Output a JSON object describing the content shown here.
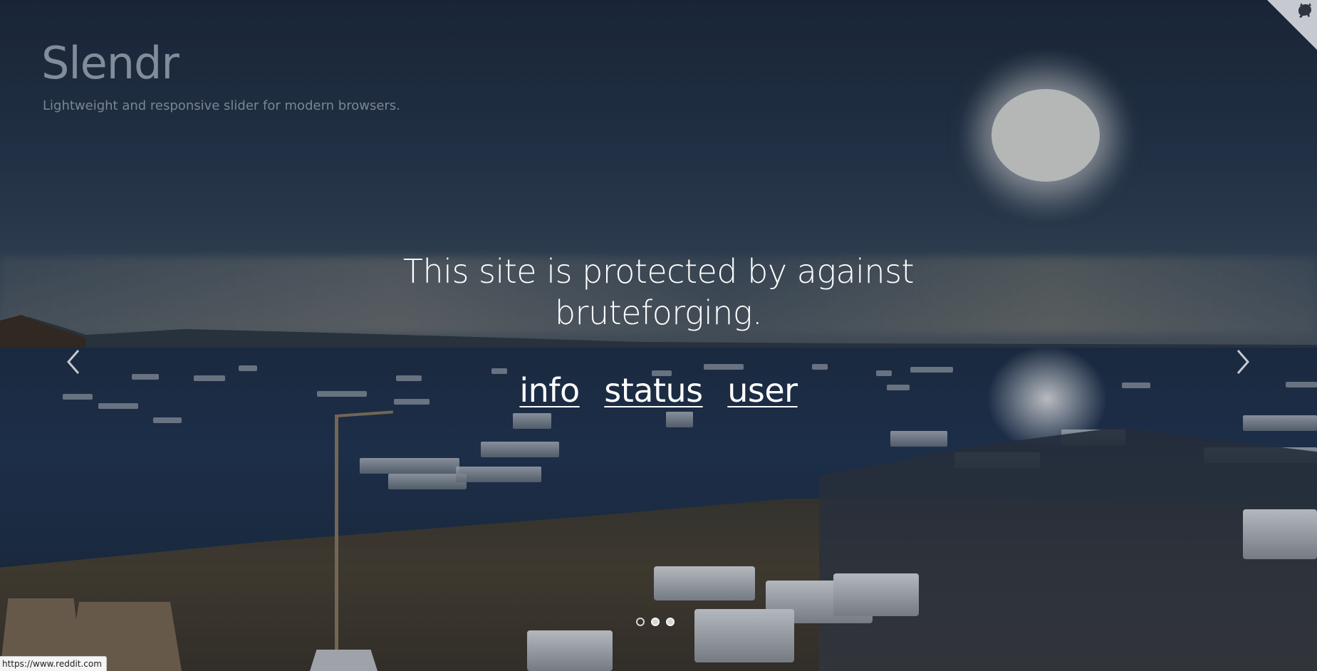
{
  "header": {
    "title": "Slendr",
    "subtitle": "Lightweight and responsive slider for modern browsers."
  },
  "slide": {
    "message": "This site is protected by against bruteforging.",
    "links": [
      {
        "label": "info"
      },
      {
        "label": "status"
      },
      {
        "label": "user"
      }
    ]
  },
  "navigation": {
    "prev_icon": "chevron-left-icon",
    "next_icon": "chevron-right-icon"
  },
  "pagination": {
    "count": 3,
    "active_index": 0
  },
  "corner_icon": "github-octocat-icon",
  "status_bar": {
    "url": "https://www.reddit.com"
  },
  "colors": {
    "text": "#ffffff",
    "title": "#8e97a6",
    "subtitle": "#7b8594"
  }
}
